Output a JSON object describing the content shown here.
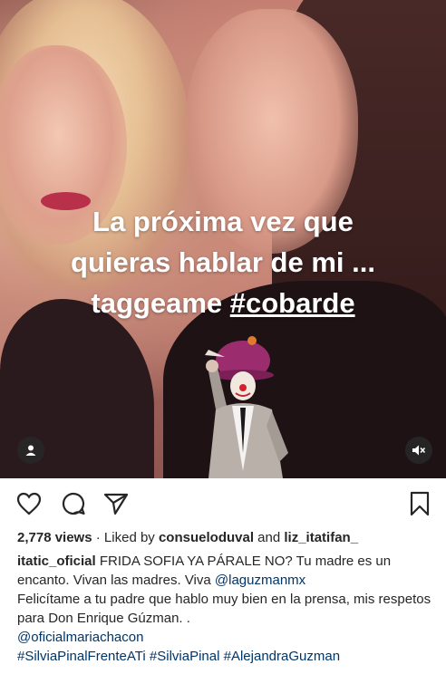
{
  "story": {
    "caption_line1": "La próxima vez que",
    "caption_line2": "quieras hablar de mi ...",
    "caption_line3_prefix": "taggeame ",
    "caption_line3_tag": "#cobarde"
  },
  "post": {
    "views": "2,778 views",
    "separator": " · ",
    "liked_prefix": "Liked by ",
    "liked_user1": "consueloduval",
    "liked_and": " and ",
    "liked_user2": "liz_itatifan_",
    "author": "itatic_oficial",
    "caption_text1": " FRIDA SOFIA YA PÁRALE NO? Tu madre es un encanto. Vivan las madres. Viva ",
    "mention1": "@laguzmanmx",
    "caption_text2": "Felicítame a tu padre que hablo muy bien en la prensa, mis respetos para Don Enrique Gúzman. .",
    "mention2": "@oficialmariachacon",
    "hashtag1": "#SilviaPinalFrenteATi",
    "hashtag2": "#SilviaPinal",
    "hashtag3": "#AlejandraGuzman"
  },
  "icons": {
    "user_tag": "person-icon",
    "mute": "speaker-muted-icon",
    "like": "heart-icon",
    "comment": "comment-icon",
    "share": "send-icon",
    "save": "bookmark-icon"
  },
  "colors": {
    "link": "#003569",
    "text": "#262626"
  }
}
